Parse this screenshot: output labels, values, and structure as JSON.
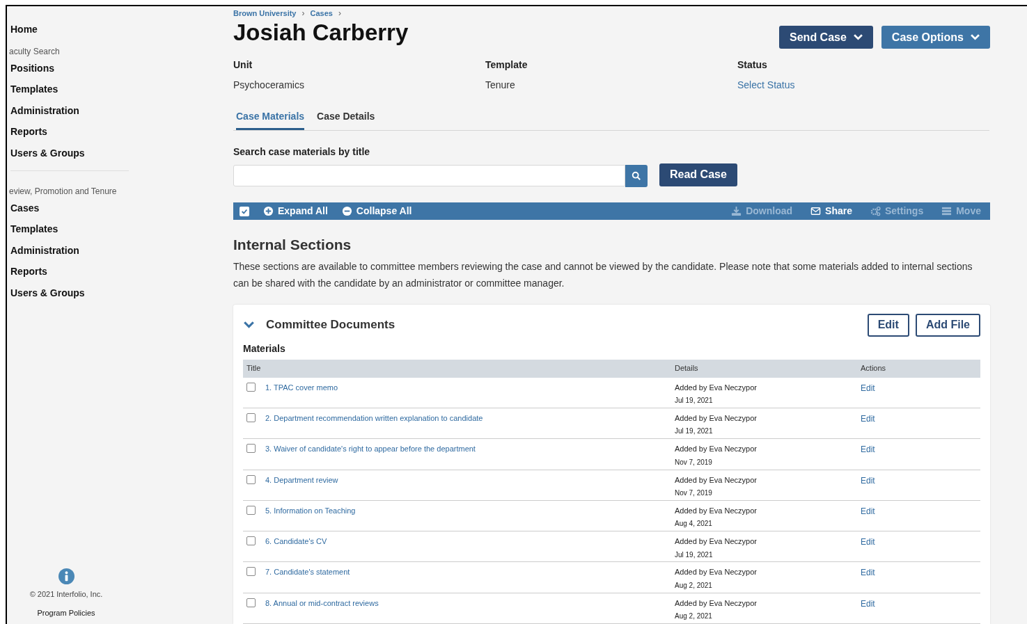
{
  "sidebar": {
    "groups": [
      {
        "items": [
          {
            "label": "Home"
          }
        ]
      },
      {
        "heading": "aculty Search",
        "items": [
          {
            "label": "Positions"
          },
          {
            "label": "Templates"
          },
          {
            "label": "Administration"
          },
          {
            "label": "Reports"
          },
          {
            "label": "Users & Groups"
          }
        ]
      },
      {
        "heading": "eview, Promotion and Tenure",
        "divider": true,
        "items": [
          {
            "label": "Cases"
          },
          {
            "label": "Templates"
          },
          {
            "label": "Administration"
          },
          {
            "label": "Reports"
          },
          {
            "label": "Users & Groups"
          }
        ]
      }
    ],
    "copyright": "© 2021 Interfolio, Inc.",
    "policies_link": "Program Policies"
  },
  "breadcrumb": [
    "Brown University",
    "Cases"
  ],
  "breadcrumb_separator": "›",
  "title": "Josiah Carberry",
  "header_buttons": [
    {
      "label": "Send Case",
      "kind": "dark"
    },
    {
      "label": "Case Options",
      "kind": "light"
    }
  ],
  "fields": [
    {
      "label": "Unit",
      "value": "Psychoceramics",
      "kind": "text"
    },
    {
      "label": "Template",
      "value": "Tenure",
      "kind": "text"
    },
    {
      "label": "Status",
      "value": "Select Status",
      "kind": "link"
    }
  ],
  "tabs": [
    {
      "label": "Case Materials",
      "selected": true
    },
    {
      "label": "Case Details",
      "selected": false
    }
  ],
  "search": {
    "label": "Search case materials by title"
  },
  "read_case_button": "Read Case",
  "toolbar": {
    "select_all_checked": true,
    "left": [
      {
        "label": "Expand All",
        "kind": "plus"
      },
      {
        "label": "Collapse All",
        "kind": "minus"
      }
    ],
    "right": [
      {
        "label": "Download",
        "kind": "download",
        "disabled": true
      },
      {
        "label": "Share",
        "kind": "mail",
        "disabled": false
      },
      {
        "label": "Settings",
        "kind": "gears",
        "disabled": true
      },
      {
        "label": "Move",
        "kind": "list",
        "disabled": true
      }
    ]
  },
  "section": {
    "title": "Internal Sections",
    "description": "These sections are available to committee members reviewing the case and cannot be viewed by the candidate. Please note that some materials added to internal sections can be shared with the candidate by an administrator or committee manager."
  },
  "panel": {
    "title": "Committee Documents",
    "expanded": true,
    "buttons": [
      "Edit",
      "Add File"
    ],
    "materials_label": "Materials",
    "columns": [
      "Title",
      "Details",
      "Actions"
    ],
    "rows": [
      {
        "title": "1. TPAC cover memo",
        "added": "Added by Eva Neczypor",
        "date": "Jul 19, 2021",
        "action": "Edit",
        "checked": false
      },
      {
        "title": "2. Department recommendation written explanation to candidate",
        "added": "Added by Eva Neczypor",
        "date": "Jul 19, 2021",
        "action": "Edit",
        "checked": false
      },
      {
        "title": "3. Waiver of candidate's right to appear before the department",
        "added": "Added by Eva Neczypor",
        "date": "Nov 7, 2019",
        "action": "Edit",
        "checked": false
      },
      {
        "title": "4. Department review",
        "added": "Added by Eva Neczypor",
        "date": "Nov 7, 2019",
        "action": "Edit",
        "checked": false
      },
      {
        "title": "5. Information on Teaching",
        "added": "Added by Eva Neczypor",
        "date": "Aug 4, 2021",
        "action": "Edit",
        "checked": false
      },
      {
        "title": "6. Candidate's CV",
        "added": "Added by Eva Neczypor",
        "date": "Jul 19, 2021",
        "action": "Edit",
        "checked": false
      },
      {
        "title": "7. Candidate's statement",
        "added": "Added by Eva Neczypor",
        "date": "Aug 2, 2021",
        "action": "Edit",
        "checked": false
      },
      {
        "title": "8. Annual or mid-contract reviews",
        "added": "Added by Eva Neczypor",
        "date": "Aug 2, 2021",
        "action": "Edit",
        "checked": false
      }
    ]
  }
}
